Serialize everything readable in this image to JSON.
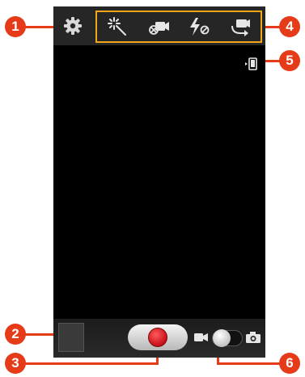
{
  "callouts": {
    "c1": "1",
    "c2": "2",
    "c3": "3",
    "c4": "4",
    "c5": "5",
    "c6": "6"
  },
  "icons": {
    "settings": "gear-icon",
    "shooting_mode": "magic-wand-icon",
    "recording_mode": "video-mode-icon",
    "flash": "flash-off-icon",
    "switch_camera": "switch-camera-icon",
    "storage": "storage-location-icon",
    "thumbnail": "gallery-thumbnail",
    "record": "record-icon",
    "mode_video": "video-camera-icon",
    "mode_photo": "photo-camera-icon"
  },
  "colors": {
    "callout": "#e53b19",
    "highlight_border": "#f2a71b",
    "record": "#c80f1a"
  },
  "mode_switch": {
    "selected": "video"
  }
}
